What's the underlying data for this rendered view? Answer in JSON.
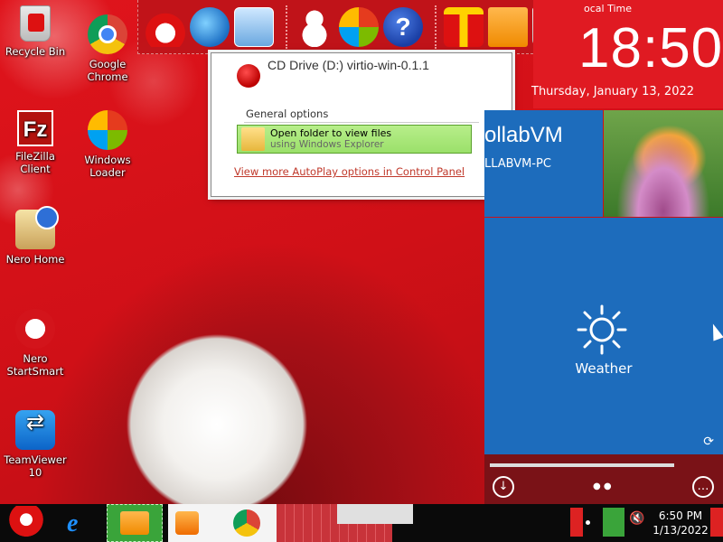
{
  "desktop": {
    "icons": [
      {
        "label": "Recycle Bin"
      },
      {
        "label": "Google Chrome"
      },
      {
        "label": "FileZilla Client"
      },
      {
        "label": "Windows Loader"
      },
      {
        "label": "Nero Home"
      },
      {
        "label": "Nero StartSmart"
      },
      {
        "label": "TeamViewer 10"
      }
    ]
  },
  "autoplay": {
    "title": "CD Drive (D:) virtio-win-0.1.1",
    "section": "General options",
    "option_title": "Open folder to view files",
    "option_sub": "using Windows Explorer",
    "link": "View more AutoPlay options in Control Panel"
  },
  "tiles": {
    "clock": {
      "label": "ocal Time",
      "time": "18:50",
      "date": "Thursday, January 13, 2022"
    },
    "collab": {
      "name": "ollabVM",
      "pc": "LLABVM-PC"
    },
    "weather": {
      "label": "Weather"
    }
  },
  "taskbar": {
    "time": "6:50 PM",
    "date": "1/13/2022"
  },
  "colors": {
    "accent_red": "#e01a22",
    "tile_blue": "#1d6cbc",
    "autoplay_option_green": "#9be06a"
  }
}
